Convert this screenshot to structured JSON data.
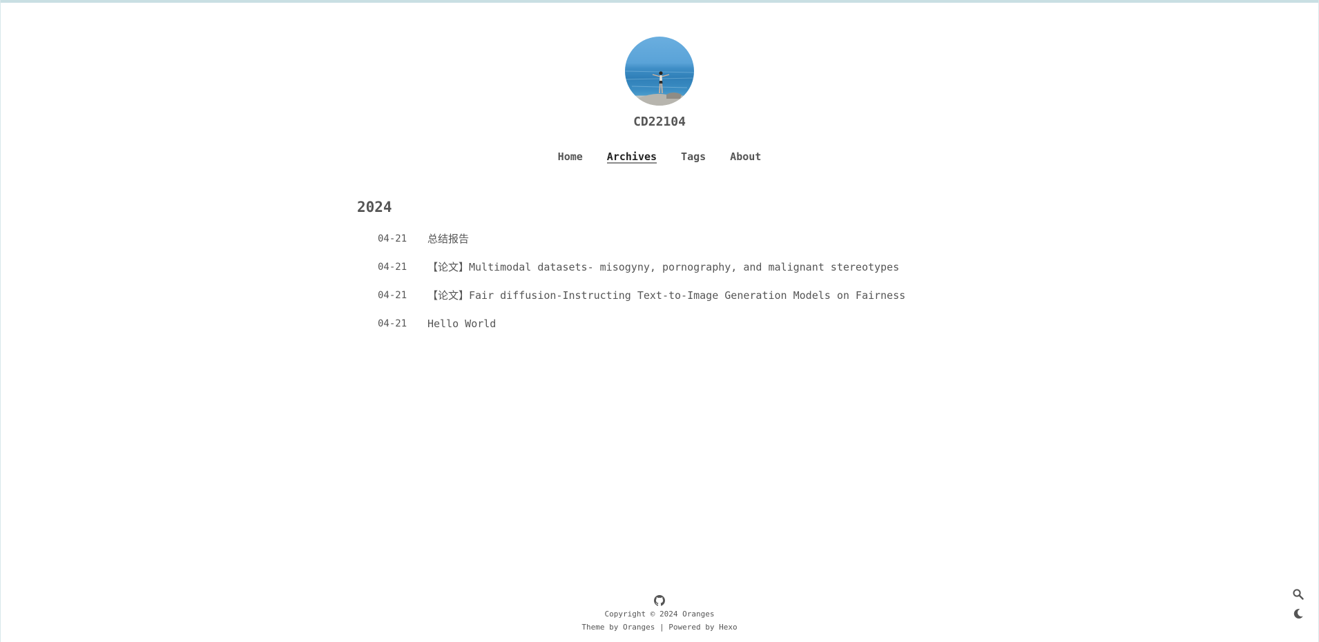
{
  "site": {
    "title": "CD22104"
  },
  "nav": {
    "items": [
      {
        "label": "Home"
      },
      {
        "label": "Archives"
      },
      {
        "label": "Tags"
      },
      {
        "label": "About"
      }
    ],
    "active": "Archives"
  },
  "archive": {
    "year": "2024",
    "posts": [
      {
        "date": "04-21",
        "title": "总结报告"
      },
      {
        "date": "04-21",
        "title": "【论文】Multimodal datasets- misogyny, pornography, and malignant stereotypes"
      },
      {
        "date": "04-21",
        "title": "【论文】Fair diffusion-Instructing Text-to-Image Generation Models on Fairness"
      },
      {
        "date": "04-21",
        "title": "Hello World"
      }
    ]
  },
  "footer": {
    "copyright": "Copyright © 2024 Oranges",
    "theme_prefix": "Theme by ",
    "theme_link": "Oranges",
    "separator": " | Powered by ",
    "powered_link": "Hexo"
  },
  "icons": {
    "github": "github-icon",
    "search": "search-icon",
    "theme": "moon-icon"
  },
  "colors": {
    "text": "#555555",
    "active_nav": "#222222",
    "top_strip": "#c9dfe3"
  }
}
